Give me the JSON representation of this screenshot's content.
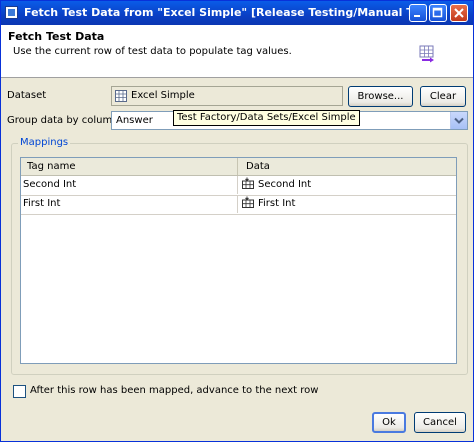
{
  "window": {
    "title": "Fetch Test Data from \"Excel Simple\" [Release Testing/Manual Tes...",
    "controls": [
      "minimize-icon",
      "maximize-icon",
      "close-icon"
    ]
  },
  "header": {
    "title": "Fetch Test Data",
    "description": "Use the current row of test data to populate tag values.",
    "icon": "table-arrow-icon"
  },
  "dataset": {
    "label": "Dataset",
    "value": "Excel Simple",
    "browse_label": "Browse...",
    "clear_label": "Clear",
    "tooltip": "Test Factory/Data Sets/Excel Simple"
  },
  "group_by": {
    "label": "Group data by column",
    "value": "Answer"
  },
  "mappings": {
    "legend": "Mappings",
    "columns": [
      "Tag name",
      "Data"
    ],
    "rows": [
      {
        "tag": "Second Int",
        "data": "Second Int"
      },
      {
        "tag": "First Int",
        "data": "First Int"
      }
    ]
  },
  "advance": {
    "label": "After this row has been mapped, advance to the next row",
    "checked": false
  },
  "footer": {
    "ok_label": "Ok",
    "cancel_label": "Cancel"
  },
  "colors": {
    "titlebar": "#0a5ce8",
    "dialog_bg": "#ece9d8",
    "legend": "#0046d5"
  }
}
